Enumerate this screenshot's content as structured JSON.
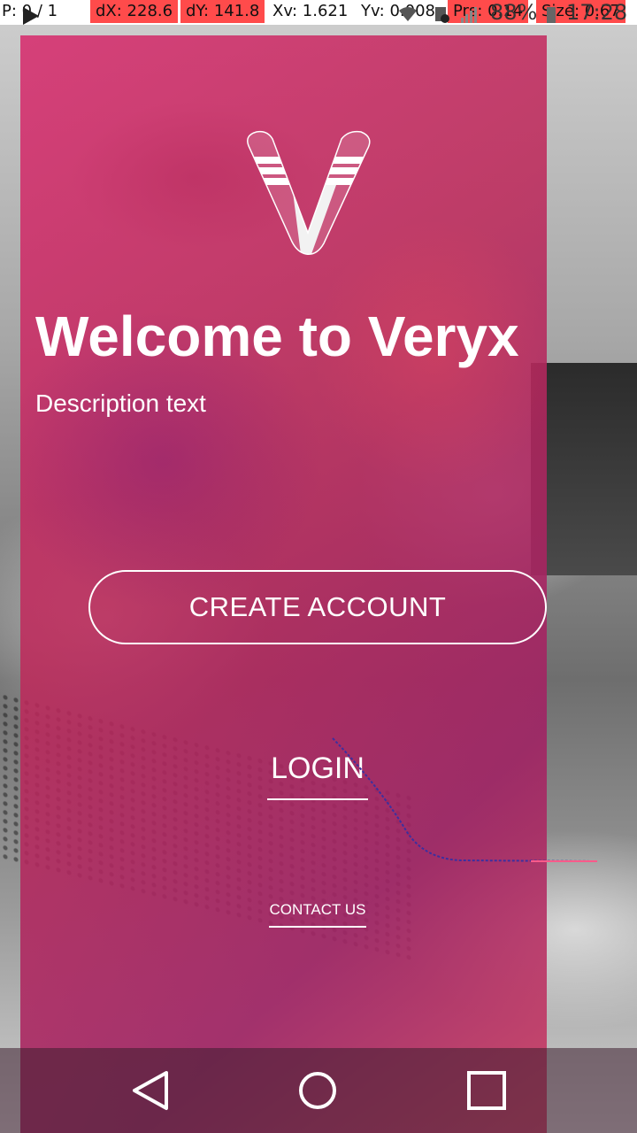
{
  "debug_overlay": {
    "pointer": "P: 0 / 1",
    "dx": "dX: 228.6",
    "dy": "dY: 141.8",
    "xv": "Xv: 1.621",
    "yv": "Yv: 0.008",
    "prs": "Prs: 0.14",
    "size": "Size: 0.67"
  },
  "status_bar": {
    "battery": "88%",
    "time": "17:28",
    "icons": [
      "play-icon",
      "usb-icon",
      "bug-icon",
      "send-icon",
      "wifi-icon",
      "sim-icon",
      "signal-icon",
      "battery-icon"
    ]
  },
  "welcome": {
    "title": "Welcome to Veryx",
    "description": "Description text"
  },
  "actions": {
    "create_account": "CREATE ACCOUNT",
    "login": "LOGIN",
    "contact_us": "CONTACT US"
  },
  "colors": {
    "overlay_primary": "#d22d6e",
    "overlay_secondary": "#a0237a",
    "text": "#ffffff",
    "debug_highlight": "#ff4b4b"
  },
  "nav_bar": {
    "buttons": [
      "back-icon",
      "home-icon",
      "recents-icon"
    ]
  }
}
